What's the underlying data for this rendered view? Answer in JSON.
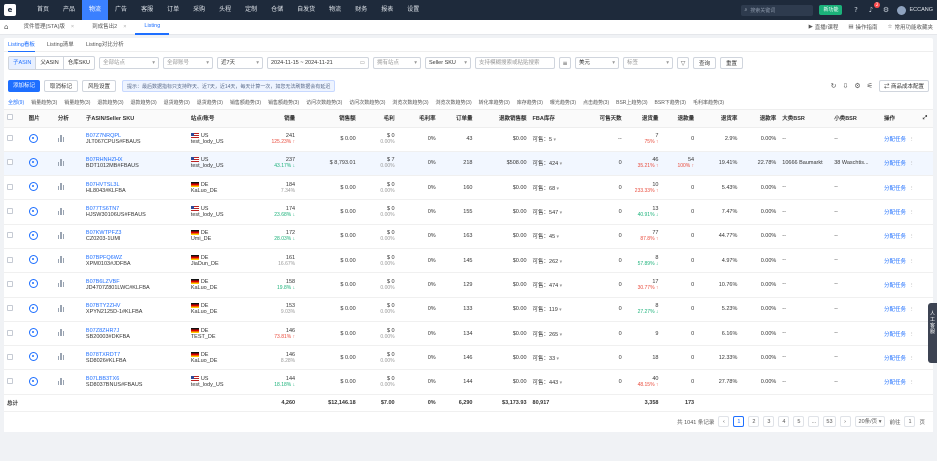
{
  "nav": {
    "logo": "e",
    "items": [
      "首页",
      "产品",
      "物流",
      "广告",
      "客服",
      "订单",
      "采购",
      "头程",
      "定制",
      "仓储",
      "自发货",
      "物流",
      "财务",
      "报表",
      "设置"
    ],
    "active_index": 2,
    "search_placeholder": "搜索关键词",
    "new_btn": "新功能",
    "notice_count": "2",
    "user": "ECCANG"
  },
  "tabs": {
    "items": [
      "货件管理(STA)版",
      "到成售出2",
      "Listing"
    ],
    "active_index": 2,
    "right": [
      "直播/课程",
      "操作指南",
      "常用功能收藏夹"
    ]
  },
  "subtabs": {
    "items": [
      "Listing看板",
      "Listing清单",
      "Listing对比分析"
    ],
    "active_index": 0
  },
  "filters": {
    "segment": [
      "子ASIN",
      "父ASIN",
      "仓库SKU"
    ],
    "segment_active": 0,
    "shop": "全部站点",
    "account": "全部账号",
    "period": "近7天",
    "date_range": "2024-11-15 ~ 2024-11-21",
    "compare": "拥有站点",
    "field": "Seller SKU",
    "search_placeholder": "支持模糊搜索或粘贴搜索",
    "currency": "美元",
    "tag": "标签",
    "query_btn": "查询",
    "reset_btn": "重置"
  },
  "actions": {
    "add": "添加标记",
    "cancel": "取消标记",
    "risk": "风险设置",
    "tip": "提示：最后数据指标只支持昨天、近7天，近14天，每天计算一次，如您无法刷数据会有延迟",
    "cost": "商品成本配置"
  },
  "coltabs": {
    "items": [
      "全部(9)",
      "销量趋势(3)",
      "销量趋势(3)",
      "退款趋势(3)",
      "退款趋势(3)",
      "退货趋势(3)",
      "退货趋势(3)",
      "销售额趋势(3)",
      "销售额趋势(3)",
      "访问次数趋势(3)",
      "访问次数趋势(3)",
      "浏览次数趋势(3)",
      "浏览次数趋势(3)",
      "转化率趋势(3)",
      "库存趋势(3)",
      "曝光趋势(3)",
      "点击趋势(3)",
      "BSR上趋势(3)",
      "BSR下趋势(3)",
      "毛利率趋势(3)"
    ],
    "active_index": 0
  },
  "table": {
    "headers": {
      "img": "图片",
      "ana": "分析",
      "asin": "子ASIN/Seller SKU",
      "site": "站点/账号",
      "sales": "销量",
      "amt": "销售额",
      "profit": "毛利",
      "margin": "毛利率",
      "orders": "订单量",
      "refund_amt": "退款销售额",
      "fba": "FBA库存",
      "days": "可售天数",
      "refunds": "退货量",
      "ret": "退款量",
      "ret_rate": "退货率",
      "refund_rate": "退款率",
      "bsr_big": "大类BSR",
      "bsr_small": "小类BSR",
      "op": "操作"
    },
    "rows": [
      {
        "asin": "B07Z7NRQPL",
        "sku": "JLT067CPUS#FBAUS",
        "flag": "us",
        "site": "US",
        "acct": "test_lody_US",
        "sales": "241",
        "sales_sub": "125.23%",
        "sales_dir": "up",
        "amt": "$ 0.00",
        "profit": "$ 0",
        "profit_sub": "0.00%",
        "margin": "0%",
        "orders": "43",
        "refund_amt": "$0.00",
        "fba": "可售：5",
        "days": "--",
        "refunds": "7",
        "refunds_sub": "75%",
        "refunds_dir": "up",
        "ret": "0",
        "ret_sub": "",
        "ret_dir": "",
        "ret_rate": "2.9%",
        "refund_rate": "0.00%",
        "bsr_big": "--",
        "bsr_small": "--",
        "op": "分配任务",
        "hl": false
      },
      {
        "asin": "B07RHNHZHX",
        "sku": "BDT1012MB#FBAUS",
        "flag": "us",
        "site": "US",
        "acct": "test_lody_US",
        "sales": "237",
        "sales_sub": "43.17%",
        "sales_dir": "dn",
        "amt": "$ 8,793.01",
        "profit": "$ 7",
        "profit_sub": "0.00%",
        "margin": "0%",
        "orders": "218",
        "refund_amt": "$508.00",
        "fba": "可售：424",
        "days": "0",
        "refunds": "46",
        "refunds_sub": "35.21%",
        "refunds_dir": "up",
        "ret": "54",
        "ret_sub": "100%",
        "ret_dir": "up",
        "ret_rate": "19.41%",
        "refund_rate": "22.78%",
        "bsr_big": "10666 Baumarkt",
        "bsr_small": "38 Waschtis...",
        "op": "分配任务",
        "hl": true
      },
      {
        "asin": "B07HVTSL3L",
        "sku": "HL8043#KLFBA",
        "flag": "de",
        "site": "DE",
        "acct": "KaLuo_DE",
        "sales": "184",
        "sales_sub": "7.34%",
        "sales_dir": "",
        "amt": "$ 0.00",
        "profit": "$ 0",
        "profit_sub": "0.00%",
        "margin": "0%",
        "orders": "160",
        "refund_amt": "$0.00",
        "fba": "可售：68",
        "days": "0",
        "refunds": "10",
        "refunds_sub": "233.33%",
        "refunds_dir": "up",
        "ret": "0",
        "ret_sub": "",
        "ret_dir": "",
        "ret_rate": "5.43%",
        "refund_rate": "0.00%",
        "bsr_big": "--",
        "bsr_small": "--",
        "op": "分配任务",
        "hl": false
      },
      {
        "asin": "B077TS6TN7",
        "sku": "HJSW30106US#FBAUS",
        "flag": "us",
        "site": "US",
        "acct": "test_lody_US",
        "sales": "174",
        "sales_sub": "23.68%",
        "sales_dir": "dn",
        "amt": "$ 0.00",
        "profit": "$ 0",
        "profit_sub": "0.00%",
        "margin": "0%",
        "orders": "155",
        "refund_amt": "$0.00",
        "fba": "可售：547",
        "days": "0",
        "refunds": "13",
        "refunds_sub": "40.91%",
        "refunds_dir": "dn",
        "ret": "0",
        "ret_sub": "",
        "ret_dir": "",
        "ret_rate": "7.47%",
        "refund_rate": "0.00%",
        "bsr_big": "--",
        "bsr_small": "--",
        "op": "分配任务",
        "hl": false
      },
      {
        "asin": "B07KWTPFZ3",
        "sku": "CZ0203-1UMI",
        "flag": "de",
        "site": "DE",
        "acct": "Umi_DE",
        "sales": "172",
        "sales_sub": "28.03%",
        "sales_dir": "dn",
        "amt": "$ 0.00",
        "profit": "$ 0",
        "profit_sub": "0.00%",
        "margin": "0%",
        "orders": "163",
        "refund_amt": "$0.00",
        "fba": "可售：45",
        "days": "0",
        "refunds": "77",
        "refunds_sub": "87.8%",
        "refunds_dir": "up",
        "ret": "0",
        "ret_sub": "",
        "ret_dir": "",
        "ret_rate": "44.77%",
        "refund_rate": "0.00%",
        "bsr_big": "--",
        "bsr_small": "--",
        "op": "分配任务",
        "hl": false
      },
      {
        "asin": "B07BPFQ6WZ",
        "sku": "XPM0103#JDFBA",
        "flag": "de",
        "site": "DE",
        "acct": "JiaDun_DE",
        "sales": "161",
        "sales_sub": "16.67%",
        "sales_dir": "",
        "amt": "$ 0.00",
        "profit": "$ 0",
        "profit_sub": "0.00%",
        "margin": "0%",
        "orders": "145",
        "refund_amt": "$0.00",
        "fba": "可售：262",
        "days": "0",
        "refunds": "8",
        "refunds_sub": "57.89%",
        "refunds_dir": "dn",
        "ret": "0",
        "ret_sub": "",
        "ret_dir": "",
        "ret_rate": "4.97%",
        "refund_rate": "0.00%",
        "bsr_big": "--",
        "bsr_small": "--",
        "op": "分配任务",
        "hl": false
      },
      {
        "asin": "B07B6LZVBF",
        "sku": "JD4707Z801LWC#KLFBA",
        "flag": "de",
        "site": "DE",
        "acct": "KaLuo_DE",
        "sales": "158",
        "sales_sub": "19.8%",
        "sales_dir": "dn",
        "amt": "$ 0.00",
        "profit": "$ 0",
        "profit_sub": "0.00%",
        "margin": "0%",
        "orders": "129",
        "refund_amt": "$0.00",
        "fba": "可售：474",
        "days": "0",
        "refunds": "17",
        "refunds_sub": "30.77%",
        "refunds_dir": "up",
        "ret": "0",
        "ret_sub": "",
        "ret_dir": "",
        "ret_rate": "10.76%",
        "refund_rate": "0.00%",
        "bsr_big": "--",
        "bsr_small": "--",
        "op": "分配任务",
        "hl": false
      },
      {
        "asin": "B07BTY2ZHV",
        "sku": "XPYN2125D-1#KLFBA",
        "flag": "de",
        "site": "DE",
        "acct": "KaLuo_DE",
        "sales": "153",
        "sales_sub": "9.03%",
        "sales_dir": "",
        "amt": "$ 0.00",
        "profit": "$ 0",
        "profit_sub": "0.00%",
        "margin": "0%",
        "orders": "133",
        "refund_amt": "$0.00",
        "fba": "可售：119",
        "days": "0",
        "refunds": "8",
        "refunds_sub": "27.27%",
        "refunds_dir": "dn",
        "ret": "0",
        "ret_sub": "",
        "ret_dir": "",
        "ret_rate": "5.23%",
        "refund_rate": "0.00%",
        "bsr_big": "--",
        "bsr_small": "--",
        "op": "分配任务",
        "hl": false
      },
      {
        "asin": "B07Z8ZHR7J",
        "sku": "SB20003#DKFBA",
        "flag": "de",
        "site": "DE",
        "acct": "TEST_DE",
        "sales": "146",
        "sales_sub": "73.81%",
        "sales_dir": "up",
        "amt": "$ 0.00",
        "profit": "$ 0",
        "profit_sub": "0.00%",
        "margin": "0%",
        "orders": "134",
        "refund_amt": "$0.00",
        "fba": "可售：265",
        "days": "0",
        "refunds": "9",
        "refunds_sub": "",
        "refunds_dir": "",
        "ret": "0",
        "ret_sub": "",
        "ret_dir": "",
        "ret_rate": "6.16%",
        "refund_rate": "0.00%",
        "bsr_big": "--",
        "bsr_small": "--",
        "op": "分配任务",
        "hl": false
      },
      {
        "asin": "B078TXRDT7",
        "sku": "SD8026#KLFBA",
        "flag": "de",
        "site": "DE",
        "acct": "KaLuo_DE",
        "sales": "146",
        "sales_sub": "8.28%",
        "sales_dir": "",
        "amt": "$ 0.00",
        "profit": "$ 0",
        "profit_sub": "0.00%",
        "margin": "0%",
        "orders": "146",
        "refund_amt": "$0.00",
        "fba": "可售：33",
        "days": "0",
        "refunds": "18",
        "refunds_sub": "",
        "refunds_dir": "",
        "ret": "0",
        "ret_sub": "",
        "ret_dir": "",
        "ret_rate": "12.33%",
        "refund_rate": "0.00%",
        "bsr_big": "--",
        "bsr_small": "--",
        "op": "分配任务",
        "hl": false
      },
      {
        "asin": "B07LBB3TX6",
        "sku": "SD8037BNUS#FBAUS",
        "flag": "us",
        "site": "US",
        "acct": "test_lody_US",
        "sales": "144",
        "sales_sub": "18.18%",
        "sales_dir": "dn",
        "amt": "$ 0.00",
        "profit": "$ 0",
        "profit_sub": "0.00%",
        "margin": "0%",
        "orders": "144",
        "refund_amt": "$0.00",
        "fba": "可售：443",
        "days": "0",
        "refunds": "40",
        "refunds_sub": "48.15%",
        "refunds_dir": "up",
        "ret": "0",
        "ret_sub": "",
        "ret_dir": "",
        "ret_rate": "27.78%",
        "refund_rate": "0.00%",
        "bsr_big": "--",
        "bsr_small": "--",
        "op": "分配任务",
        "hl": false
      }
    ],
    "total": {
      "label": "总计",
      "sales": "4,260",
      "amt": "$12,146.18",
      "profit": "$7.00",
      "margin": "0%",
      "orders": "6,290",
      "refund_amt": "$3,173.93",
      "fba": "80,917",
      "refunds": "3,358",
      "ret": "173"
    }
  },
  "pager": {
    "total": "共 1041 条记录",
    "pages": [
      "1",
      "2",
      "3",
      "4",
      "5",
      "...",
      "53"
    ],
    "active": "1",
    "page_size": "20条/页",
    "goto_label": "前往",
    "goto_value": "1",
    "goto_unit": "页"
  },
  "side_float": "人工客服"
}
